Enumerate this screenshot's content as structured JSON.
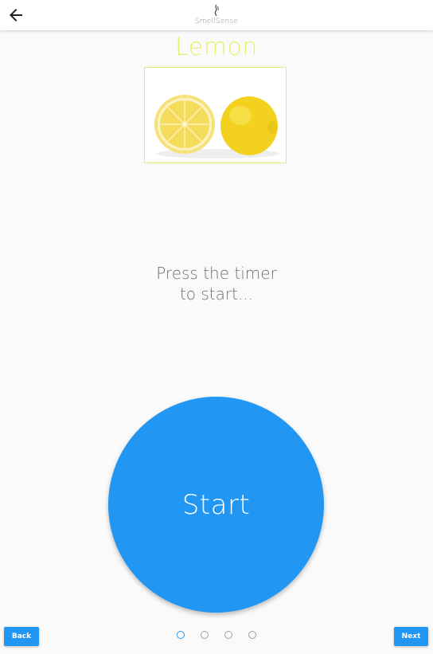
{
  "header": {
    "app_title": "SmellSense",
    "back_icon": "arrow-left-icon",
    "logo_icon": "smell-wisp-icon"
  },
  "main": {
    "fruit_name": "Lemon",
    "image_icon": "lemon-photo",
    "instruction_line1": "Press the timer",
    "instruction_line2": "to start...",
    "start_label": "Start"
  },
  "footer": {
    "back_label": "Back",
    "next_label": "Next",
    "page_count": 4,
    "active_page": 1
  },
  "colors": {
    "accent": "#e7ee6c",
    "primary": "#2196f3",
    "background": "#fafafa"
  }
}
